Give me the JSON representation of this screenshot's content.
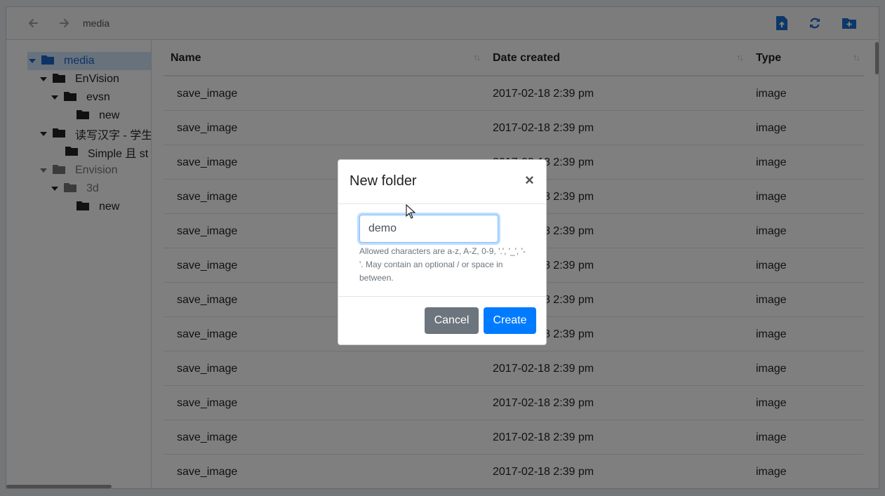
{
  "toolbar": {
    "breadcrumb": "media",
    "icons": [
      "arrow-left-icon",
      "arrow-right-icon",
      "file-upload-icon",
      "refresh-icon",
      "folder-plus-icon"
    ],
    "accent": "#1a6fd0"
  },
  "tree": [
    {
      "label": "media",
      "active": true
    },
    {
      "label": "EnVision"
    },
    {
      "label": "evsn"
    },
    {
      "label": "new"
    },
    {
      "label": "读写汉字 - 学生"
    },
    {
      "label": "Simple 且 st"
    },
    {
      "label": "Envision",
      "dim": true
    },
    {
      "label": "3d",
      "dim": true
    },
    {
      "label": "new"
    }
  ],
  "table": {
    "columns": [
      "Name",
      "Date created",
      "Type"
    ],
    "rows": [
      [
        "save_image",
        "2017-02-18 2:39 pm",
        "image"
      ],
      [
        "save_image",
        "2017-02-18 2:39 pm",
        "image"
      ],
      [
        "save_image",
        "2017-02-18 2:39 pm",
        "image"
      ],
      [
        "save_image",
        "2017-02-18 2:39 pm",
        "image"
      ],
      [
        "save_image",
        "2017-02-18 2:39 pm",
        "image"
      ],
      [
        "save_image",
        "2017-02-18 2:39 pm",
        "image"
      ],
      [
        "save_image",
        "2017-02-18 2:39 pm",
        "image"
      ],
      [
        "save_image",
        "2017-02-18 2:39 pm",
        "image"
      ],
      [
        "save_image",
        "2017-02-18 2:39 pm",
        "image"
      ],
      [
        "save_image",
        "2017-02-18 2:39 pm",
        "image"
      ],
      [
        "save_image",
        "2017-02-18 2:39 pm",
        "image"
      ],
      [
        "save_image",
        "2017-02-18 2:39 pm",
        "image"
      ]
    ]
  },
  "modal": {
    "title": "New folder",
    "close": "×",
    "input_value": "demo",
    "help": "Allowed characters are a-z, A-Z, 0-9, '.', '_', '-'. May contain an optional / or space in between.",
    "cancel_label": "Cancel",
    "create_label": "Create"
  }
}
